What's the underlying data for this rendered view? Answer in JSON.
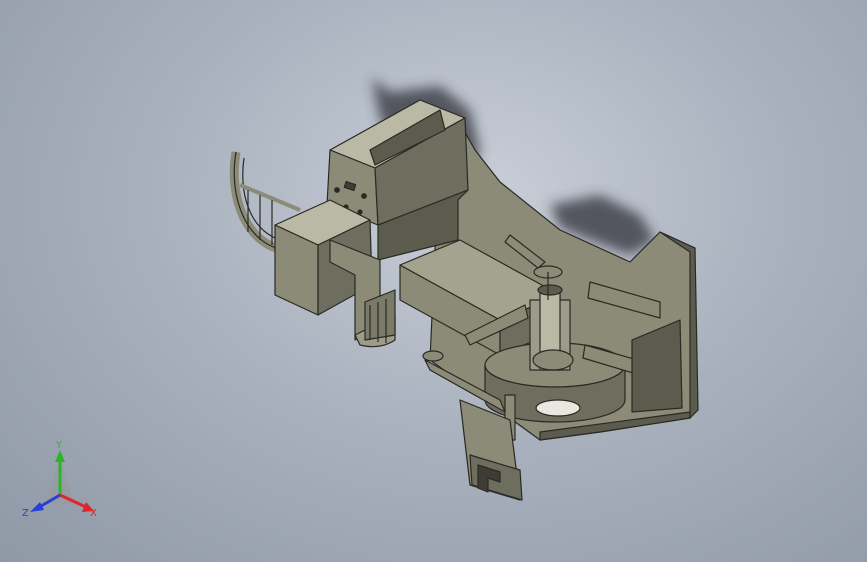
{
  "viewport": {
    "background_top": "#c9cfd8",
    "background_bottom": "#8f98a6"
  },
  "model": {
    "body_color": "#8b8b78",
    "dark_color": "#5b5b4e",
    "light_color": "#b9b9a6",
    "edge_color": "#2a2a24",
    "shadow_color": "#30333a"
  },
  "triad": {
    "x_label": "X",
    "y_label": "Y",
    "z_label": "Z",
    "x_color": "#e0262a",
    "y_color": "#2bb52b",
    "z_color": "#2a3fd6"
  }
}
